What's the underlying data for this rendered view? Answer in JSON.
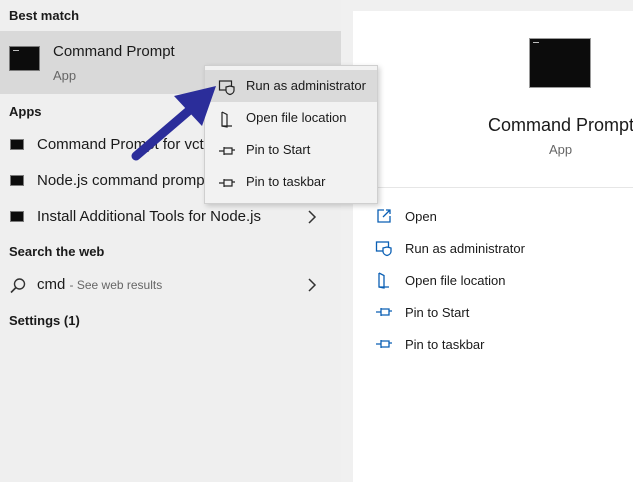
{
  "left_panel": {
    "best_match_header": "Best match",
    "best_match": {
      "title": "Command Prompt",
      "subtitle": "App"
    },
    "apps_header": "Apps",
    "apps": [
      {
        "label": "Command Prompt for vctools",
        "icon": "cmd-icon",
        "has_chevron": false
      },
      {
        "label": "Node.js command prompt",
        "icon": "cmd-icon",
        "has_chevron": false
      },
      {
        "label": "Install Additional Tools for Node.js",
        "icon": "cmd-icon",
        "has_chevron": true
      }
    ],
    "search_web_header": "Search the web",
    "web_result": {
      "query": "cmd",
      "hint": "- See web results"
    },
    "settings_header": "Settings (1)"
  },
  "context_menu": {
    "items": [
      {
        "label": "Run as administrator",
        "icon": "shield-icon",
        "highlighted": true
      },
      {
        "label": "Open file location",
        "icon": "folder-icon",
        "highlighted": false
      },
      {
        "label": "Pin to Start",
        "icon": "pin-icon",
        "highlighted": false
      },
      {
        "label": "Pin to taskbar",
        "icon": "pin-icon",
        "highlighted": false
      }
    ]
  },
  "right_panel": {
    "app_title": "Command Prompt",
    "app_subtitle": "App",
    "actions": [
      {
        "label": "Open",
        "icon": "open-icon"
      },
      {
        "label": "Run as administrator",
        "icon": "shield-icon"
      },
      {
        "label": "Open file location",
        "icon": "folder-icon"
      },
      {
        "label": "Pin to Start",
        "icon": "pin-icon"
      },
      {
        "label": "Pin to taskbar",
        "icon": "pin-icon"
      }
    ]
  },
  "colors": {
    "accent": "#0a5fb4",
    "arrow": "#2b2d9a",
    "highlight": "#d9d9d9"
  }
}
